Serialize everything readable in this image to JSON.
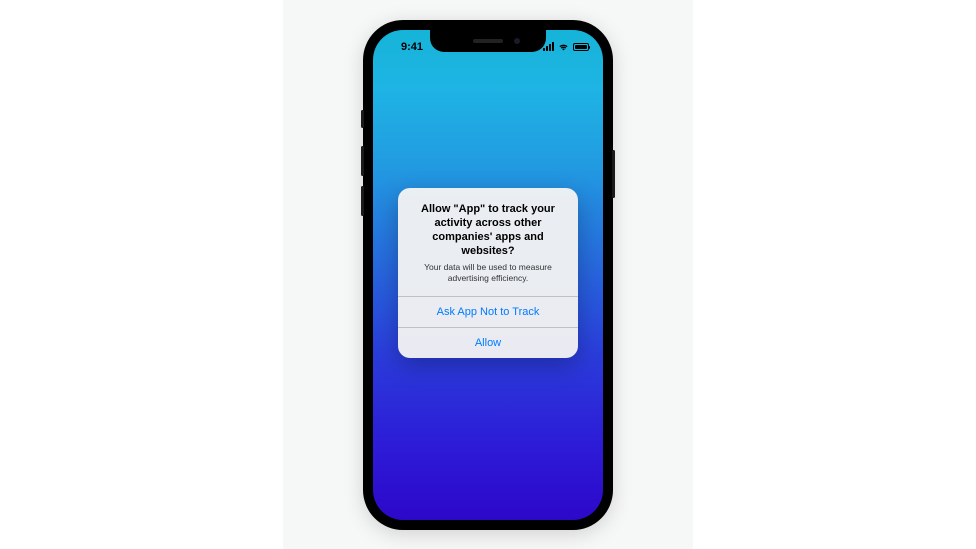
{
  "status": {
    "time": "9:41"
  },
  "alert": {
    "title": "Allow \"App\" to track your activity across other companies' apps and websites?",
    "message": "Your data will be used to measure advertising efficiency.",
    "button_deny": "Ask App Not to Track",
    "button_allow": "Allow"
  }
}
